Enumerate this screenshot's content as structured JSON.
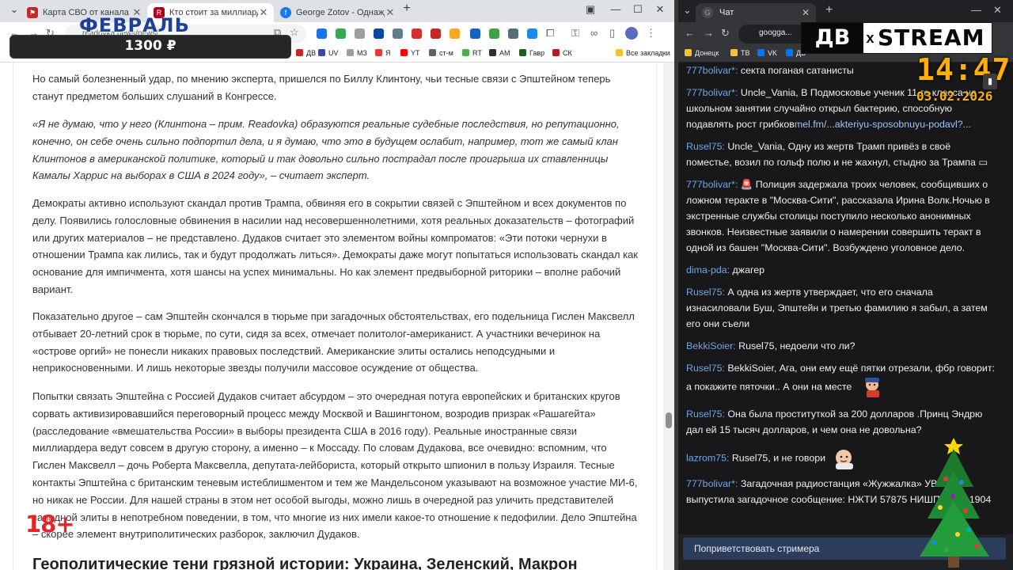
{
  "left_browser": {
    "tabs": [
      {
        "title": "Карта СВО от канала DIVGEN",
        "favicon": "red-flag-icon",
        "active": false
      },
      {
        "title": "Кто стоит за миллиардером-п",
        "favicon": "readovka-icon",
        "active": true
      },
      {
        "title": "George Zotov - Однажды Геор",
        "favicon": "facebook-icon",
        "active": false
      }
    ],
    "url": "readovka.news/news/...",
    "bookmarks": [
      "ДВ",
      "UV",
      "МЗ",
      "Я",
      "YT",
      "ст-м",
      "RT",
      "AM",
      "Гавр",
      "СК",
      "Все закладки"
    ]
  },
  "promo": {
    "title": "ФЕВРАЛЬ",
    "price": "1300 ₽"
  },
  "article": {
    "p1": "Но самый болезненный удар, по мнению эксперта, пришелся по Биллу Клинтону, чьи тесные связи с Эпштейном теперь станут предметом больших слушаний в Конгрессе.",
    "p2": "«Я не думаю, что у него (Клинтона – прим. Readovka) образуются реальные судебные последствия, но репутационно, конечно, он себе очень сильно подпортил дела, и я думаю, что это в будущем ослабит, например, тот же самый клан Клинтонов в американской политике, который и так довольно сильно пострадал после проигрыша их ставленницы Камалы Харрис на выборах в США в 2024 году», – считает эксперт.",
    "p3": "Демократы активно используют скандал против Трампа, обвиняя его в сокрытии связей с Эпштейном и всех документов по делу. Появились голословные обвинения в насилии над несовершеннолетними, хотя реальных доказательств – фотографий или других материалов – не представлено. Дудаков считает это элементом войны компроматов: «Эти потоки чернухи в отношении Трампа как лились, так и будут продолжать литься». Демократы даже могут попытаться использовать скандал как основание для импичмента, хотя шансы на успех минимальны. Но как элемент предвыборной риторики – вполне рабочий вариант.",
    "p4": "Показательно другое – сам Эпштейн скончался в тюрьме при загадочных обстоятельствах, его подельница Гислен Максвелл отбывает 20-летний срок в тюрьме, по сути, сидя за всех, отмечает политолог-американист. А участники вечеринок на «острове оргий» не понесли никаких правовых последствий. Американские элиты остались неподсудными и неприкосновенными. И лишь некоторые звезды получили массовое осуждение от общества.",
    "p5": "Попытки связать Эпштейна с Россией Дудаков считает абсурдом – это очередная потуга европейских и британских кругов сорвать активизировавшийся переговорный процесс между Москвой и Вашингтоном, возродив призрак «Рашагейта» (расследование «вмешательства России» в выборы президента США в 2016 году). Реальные иностранные связи миллиардера ведут совсем в другую сторону, а именно – к Моссаду. По словам Дудакова, все очевидно: вспомним, что Гислен Максвелл – дочь Роберта Максвелла, депутата-лейбориста, который открыто шпионил в пользу Израиля. Тесные контакты Эпштейна с британским теневым истеблишментом и тем же Мандельсоном указывают на возможное участие МИ-6, но никак не России. Для нашей страны в этом нет особой выгоды, можно лишь в очередной раз уличить представителей западной элиты в непотребном поведении, в том, что многие из них имели какое-то отношение к педофилии. Дело Эпштейна – скорее элемент внутриполитических разборок, заключил Дудаков.",
    "heading": "Геополитические тени грязной истории: Украина, Зеленский, Макрон"
  },
  "age_rating": "18+",
  "right_browser": {
    "tab_title": "Чат",
    "url": "googga...",
    "bookmarks": [
      "Донецк",
      "ТВ",
      "VK",
      "ДВ"
    ]
  },
  "overlay": {
    "logo_left": "ДВ",
    "logo_x": "x",
    "logo_right": "STREAM",
    "time": "14:47",
    "date": "03.02.2026"
  },
  "chat": {
    "messages": [
      {
        "user": "777bolivar*:",
        "text": " секта поганая сатанисты"
      },
      {
        "user": "777bolivar*:",
        "text": " Uncle_Vania, В Подмосковье ученик 11-го класса на школьном занятии случайно открыл бактерию, способную подавлять рост грибков",
        "link": "mel.fm/...akteriyu-sposobnuyu-podavl?..."
      },
      {
        "user": "Rusel75:",
        "text": " Uncle_Vania, Одну из жертв Трамп привёз в своё поместье, возил по гольф полю и не жахнул, стыдно за Трампа ▭"
      },
      {
        "user": "777bolivar*:",
        "text": " 🚨 Полиция задержала троих человек, сообщивших о ложном теракте в \"Москва-Сити\", рассказала Ирина Волк.Ночью в экстренные службы столицы поступило несколько анонимных звонков. Неизвестные заявили о намерении совершить теракт в одной из башен \"Москва-Сити\". Возбуждено уголовное дело."
      },
      {
        "user": "dima-pda:",
        "text": " джагер"
      },
      {
        "user": "Rusel75:",
        "text": " А одна из жертв утверждает, что его сначала изнасиловали Буш, Эпштейн и третью фамилию я забыл, а затем его они съели"
      },
      {
        "user": "BekkiSoier:",
        "text": " Rusel75, недоели что ли?"
      },
      {
        "user": "Rusel75:",
        "text": " BekkiSoier, Ага, они ему ещё пятки отрезали, фбр говорит: а покажите пяточки.. А они на месте"
      },
      {
        "user": "Rusel75:",
        "text": " Она была проституткой за 200 долларов .Принц Эндрю дал ей 15 тысяч долларов, и чем она не довольна?"
      },
      {
        "user": "lazrom75:",
        "text": " Rusel75, и не говори"
      },
      {
        "user": "777bolivar*:",
        "text": " Загадочная радиостанция «Жужжалка» УВБ-76 выпустила загадочное сообщение: НЖТИ 57875 НИШПАРОТ 1904"
      }
    ],
    "input_placeholder": "Поприветствовать стримера"
  }
}
